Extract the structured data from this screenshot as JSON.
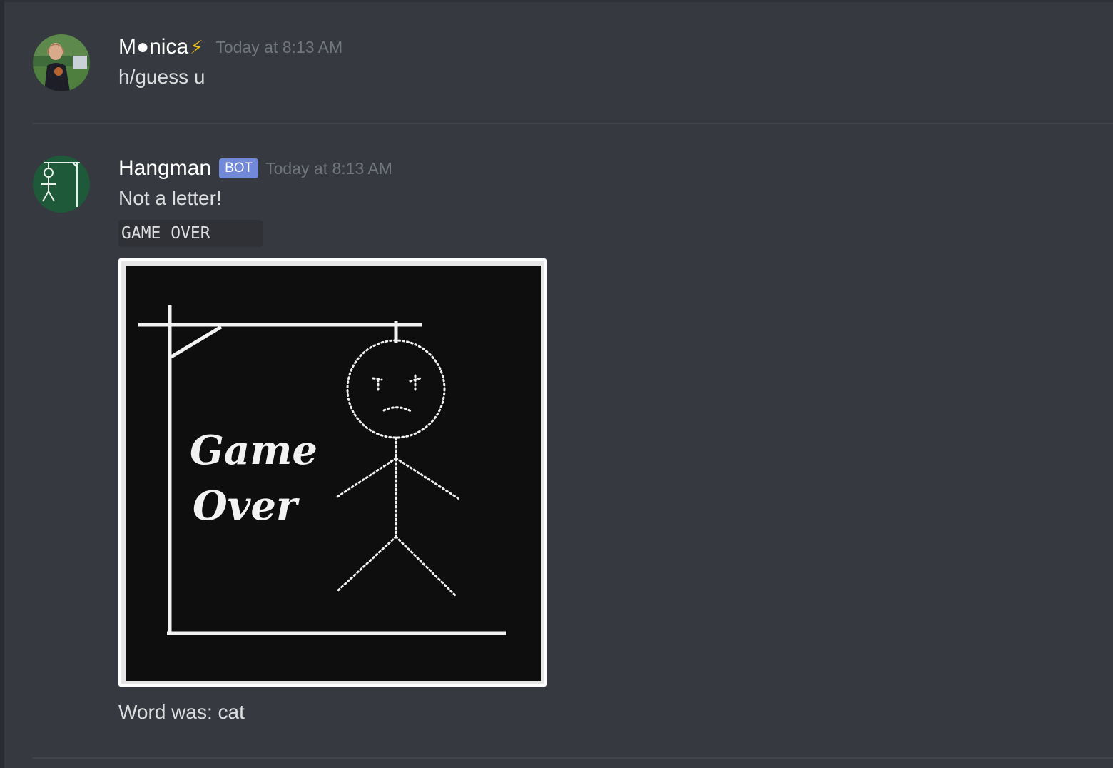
{
  "messages": [
    {
      "username": "M●nica",
      "username_badge": "⚡",
      "timestamp": "Today at 8:13 AM",
      "text": "h/guess u"
    },
    {
      "username": "Hangman",
      "bot_tag": "BOT",
      "timestamp": "Today at 8:13 AM",
      "text": "Not a letter!",
      "code_block": "GAME OVER",
      "image": {
        "title_line1": "Game",
        "title_line2": "Over"
      },
      "footer_text": "Word was: cat"
    }
  ],
  "colors": {
    "background": "#36393f",
    "username": "#ffffff",
    "timestamp": "#72767d",
    "message_text": "#dcddde",
    "bot_tag": "#7289da",
    "code_block_bg": "#2f3136",
    "divider": "#42454a",
    "lightning": "#f5c518"
  },
  "icons": {
    "monica_avatar": "user-photo-avatar",
    "hangman_avatar": "hangman-gallows-avatar",
    "lightning_badge": "lightning-bolt-icon"
  }
}
